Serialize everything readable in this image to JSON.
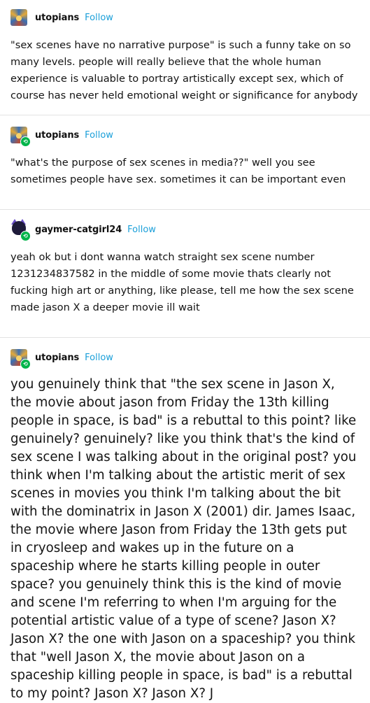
{
  "follow_label": "Follow",
  "posts": [
    {
      "username": "utopians",
      "follow": "Follow",
      "text": "\"sex scenes have no narrative purpose\" is such a funny take on so many levels. people will really believe that the whole human experience is valuable to portray artistically except sex, which of course has never held emotional weight or significance for anybody"
    },
    {
      "username": "utopians",
      "follow": "Follow",
      "text": "\"what's the purpose of sex scenes in media??\" well you see sometimes people have sex. sometimes it can be important even"
    },
    {
      "username": "gaymer-catgirl24",
      "follow": "Follow",
      "text": "yeah ok but i dont wanna watch straight sex scene number 1231234837582 in the middle of some movie thats clearly not fucking high art or anything, like please, tell me how the sex scene made jason X a deeper movie ill wait"
    },
    {
      "username": "utopians",
      "follow": "Follow",
      "text": "you genuinely think that \"the sex scene in Jason X, the movie about jason from Friday the 13th killing people in space, is bad\" is a rebuttal to this point? like genuinely? genuinely? like you think that's the kind of sex scene I was talking about in the original post? you think when I'm talking about the artistic merit of sex scenes in movies you think I'm talking about the bit with the dominatrix in Jason X (2001) dir. James Isaac, the movie where Jason from Friday the 13th gets put in cryosleep and wakes up in the future on a spaceship where he starts killing people in outer space? you genuinely think this is the kind of movie and scene I'm referring to when I'm arguing for the potential artistic value of a type of scene? Jason X? Jason X? the one with Jason on a spaceship? you think that \"well Jason X, the movie about Jason on a spaceship killing people in space, is bad\" is a rebuttal to my point? Jason X? Jason X? J"
    }
  ]
}
